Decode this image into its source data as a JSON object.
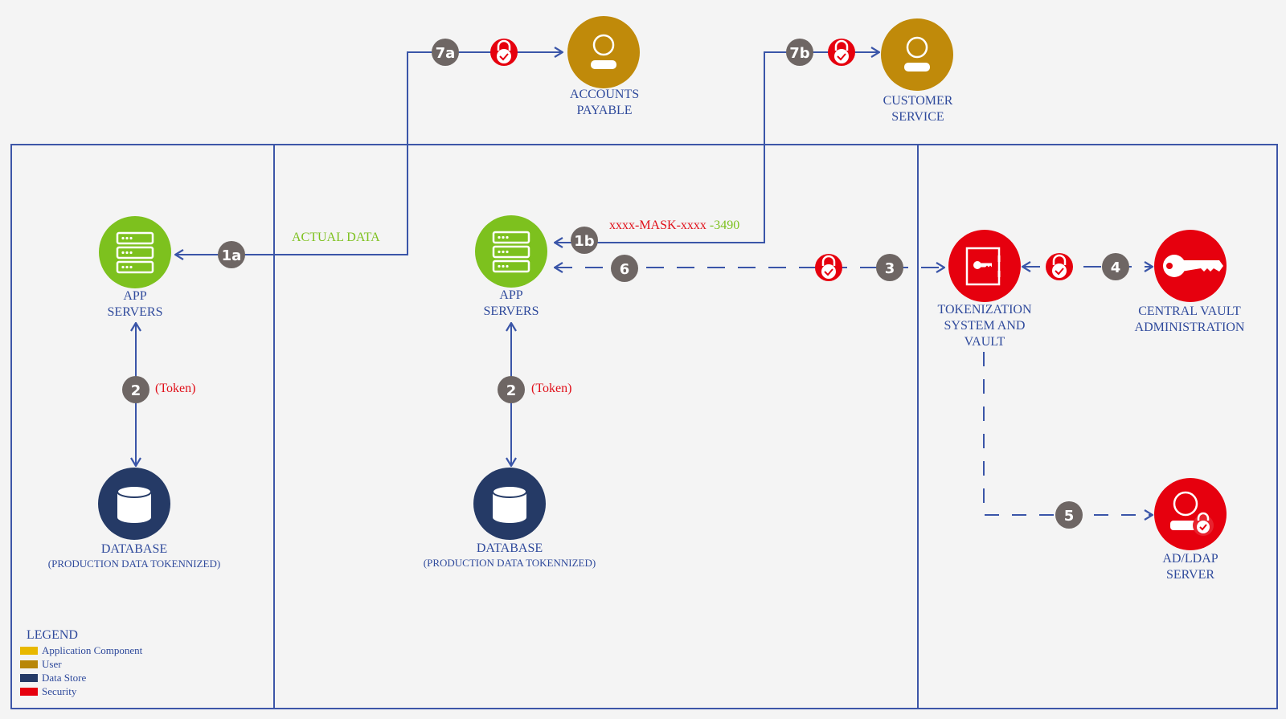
{
  "colors": {
    "line": "#3a55a8",
    "border": "#3d56a8",
    "app_component": "#7dc11e",
    "user": "#c08a0a",
    "data_store": "#253a66",
    "security": "#e6000e",
    "badge": "#6e6664",
    "legend_app": "#e8b800",
    "legend_user": "#b88708",
    "legend_store": "#253a66",
    "legend_security": "#e6000e"
  },
  "nodes": {
    "accounts_payable": {
      "line1": "ACCOUNTS",
      "line2": "PAYABLE",
      "icon": "user-icon"
    },
    "customer_service": {
      "line1": "CUSTOMER",
      "line2": "SERVICE",
      "icon": "user-icon"
    },
    "app_servers_left": {
      "line1": "APP",
      "line2": "SERVERS",
      "icon": "server-icon"
    },
    "app_servers_mid": {
      "line1": "APP",
      "line2": "SERVERS",
      "icon": "server-icon"
    },
    "database_left": {
      "line1": "DATABASE",
      "line2": "(PRODUCTION DATA TOKENNIZED)",
      "icon": "database-icon"
    },
    "database_mid": {
      "line1": "DATABASE",
      "line2": "(PRODUCTION DATA TOKENNIZED)",
      "icon": "database-icon"
    },
    "tokenization": {
      "line1": "TOKENIZATION",
      "line2": "SYSTEM AND",
      "line3": "VAULT",
      "icon": "vault-icon"
    },
    "central_vault": {
      "line1": "CENTRAL VAULT",
      "line2": "ADMINISTRATION",
      "icon": "key-icon"
    },
    "ad_ldap": {
      "line1": "AD/LDAP",
      "line2": "SERVER",
      "icon": "user-lock-icon"
    }
  },
  "steps": {
    "s1a": "1a",
    "s1b": "1b",
    "s2_left": "2",
    "s2_mid": "2",
    "s3": "3",
    "s4": "4",
    "s5": "5",
    "s6": "6",
    "s7a": "7a",
    "s7b": "7b"
  },
  "annotations": {
    "actual_data": "ACTUAL DATA",
    "mask_part": "xxxx-MASK-xxxx",
    "mask_digits": "-3490",
    "token_left": "(Token)",
    "token_mid": "(Token)"
  },
  "legend": {
    "title": "LEGEND",
    "items": [
      {
        "label": "Application Component",
        "color": "#e8b800"
      },
      {
        "label": "User",
        "color": "#b88708"
      },
      {
        "label": "Data Store",
        "color": "#253a66"
      },
      {
        "label": "Security",
        "color": "#e6000e"
      }
    ]
  }
}
